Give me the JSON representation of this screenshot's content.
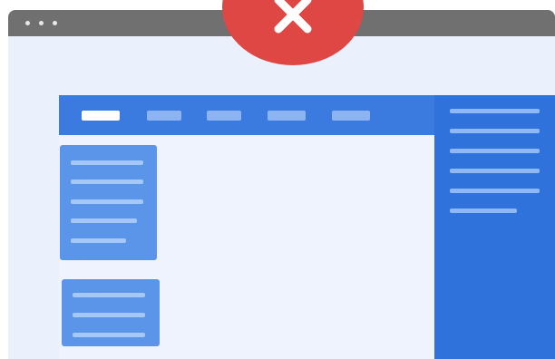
{
  "window": {
    "controls": [
      "window-dot",
      "window-dot",
      "window-dot"
    ]
  },
  "colors": {
    "titlebar": "#707070",
    "page_background": "#eaf0fc",
    "navbar": "#3b7be0",
    "right_panel": "#2f72db",
    "card": "#5a95ea",
    "content": "#eef3fd",
    "close_badge": "#df4744"
  },
  "navbar": {
    "items": [
      {
        "name": "nav-item-1",
        "active": true
      },
      {
        "name": "nav-item-2",
        "active": false
      },
      {
        "name": "nav-item-3",
        "active": false
      },
      {
        "name": "nav-item-4",
        "active": false
      },
      {
        "name": "nav-item-5",
        "active": false
      }
    ]
  },
  "overlay": {
    "icon": "close-icon"
  }
}
